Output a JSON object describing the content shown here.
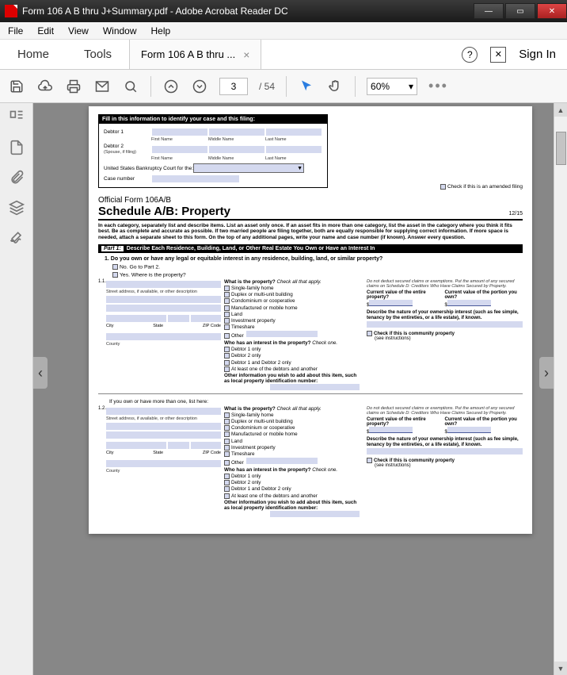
{
  "titlebar": {
    "title": "Form 106 A B thru J+Summary.pdf - Adobe Acrobat Reader DC"
  },
  "menu": {
    "file": "File",
    "edit": "Edit",
    "view": "View",
    "window": "Window",
    "help": "Help"
  },
  "tabs": {
    "home": "Home",
    "tools": "Tools",
    "doc": "Form 106 A B thru ...",
    "signin": "Sign In"
  },
  "toolbar": {
    "page": "3",
    "total": "/ 54",
    "zoom": "60%"
  },
  "form": {
    "idhead": "Fill in this information to identify your case and this filing:",
    "debtor1": "Debtor 1",
    "debtor2": "Debtor 2",
    "spouse": "(Spouse, if filing)",
    "first": "First Name",
    "middle": "Middle Name",
    "last": "Last Name",
    "court": "United States Bankruptcy Court for the:",
    "casenum": "Case number",
    "amend": "Check if this is an amended filing",
    "official": "Official Form 106A/B",
    "title": "Schedule A/B: Property",
    "date": "12/15",
    "instr": "In each category, separately list and describe items. List an asset only once. If an asset fits in more than one category, list the asset in the category where you think it fits best. Be as complete and accurate as possible. If two married people are filing together, both are equally responsible for supplying correct information. If more space is needed, attach a separate sheet to this form. On the top of any additional pages, write your name and case number (if known). Answer every question.",
    "part1": "Part 1:",
    "part1t": "Describe Each Residence, Building, Land, or Other Real Estate You Own or Have an Interest In",
    "q1": "1.  Do you own or have any legal or equitable interest in any residence, building, land, or similar property?",
    "no": "No. Go to Part 2.",
    "yes": "Yes. Where is the property?",
    "n11": "1.1.",
    "n12": "1.2.",
    "addr": "Street address, if available, or other description",
    "city": "City",
    "state": "State",
    "zip": "ZIP Code",
    "county": "County",
    "whatis": "What is the property?",
    "checkall": "Check all that apply.",
    "p1": "Single-family home",
    "p2": "Duplex or multi-unit building",
    "p3": "Condominium or cooperative",
    "p4": "Manufactured or mobile home",
    "p5": "Land",
    "p6": "Investment property",
    "p7": "Timeshare",
    "p8": "Other",
    "who": "Who has an interest in the property?",
    "checkone": "Check one.",
    "w1": "Debtor 1 only",
    "w2": "Debtor 2 only",
    "w3": "Debtor 1 and Debtor 2 only",
    "w4": "At least one of the debtors and another",
    "otherinfo": "Other information you wish to add about this item, such as local property identification number:",
    "nodeduct": "Do not deduct secured claims or exemptions. Put the amount of any secured claims on Schedule D: Creditors Who Have Claims Secured by Property.",
    "cv1": "Current value of the entire property?",
    "cv2": "Current value of the portion you own?",
    "ds": "$",
    "nature": "Describe the nature of your ownership interest (such as fee simple, tenancy by the entireties, or a life estate), if known.",
    "community": "Check if this is community property",
    "see": "(see instructions)",
    "listhere": "If you own or have more than one, list here:"
  }
}
